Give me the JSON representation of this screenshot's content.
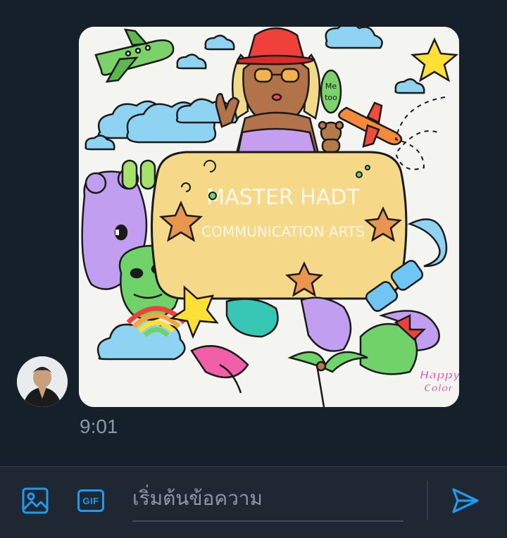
{
  "thread": {
    "message": {
      "time": "9:01",
      "image_text": {
        "bubble_note": "Me too",
        "banner_line1": "MASTER HADT",
        "banner_line2": "COMMUNICATION ARTS",
        "logo": "Happy Color"
      },
      "sender_avatar_icon": "user-avatar"
    }
  },
  "composer": {
    "placeholder": "เริ่มต้นข้อความ",
    "value": "",
    "gif_label": "GIF",
    "media_icon": "image-icon",
    "send_icon": "send-icon"
  },
  "colors": {
    "background": "#15202b",
    "accent": "#1d9bf0",
    "muted_text": "#8899a6"
  }
}
